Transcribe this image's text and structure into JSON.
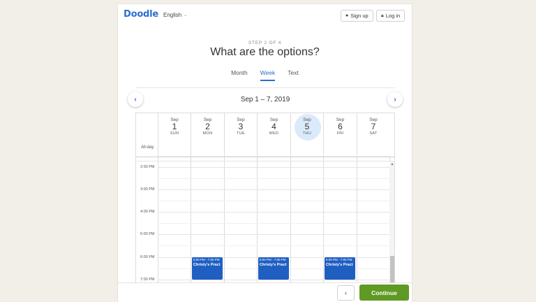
{
  "header": {
    "logo": "Doodle",
    "language": "English",
    "signup_label": "Sign up",
    "login_label": "Log in"
  },
  "step": "STEP 2 OF 4",
  "title": "What are the options?",
  "tabs": [
    {
      "label": "Month",
      "active": false
    },
    {
      "label": "Week",
      "active": true
    },
    {
      "label": "Text",
      "active": false
    }
  ],
  "calendar": {
    "range": "Sep 1 – 7, 2019",
    "all_day_label": "All-day",
    "days": [
      {
        "month": "Sep",
        "num": "1",
        "dow": "SUN",
        "today": false
      },
      {
        "month": "Sep",
        "num": "2",
        "dow": "MON",
        "today": false
      },
      {
        "month": "Sep",
        "num": "3",
        "dow": "TUE",
        "today": false
      },
      {
        "month": "Sep",
        "num": "4",
        "dow": "WED",
        "today": false
      },
      {
        "month": "Sep",
        "num": "5",
        "dow": "THU",
        "today": true
      },
      {
        "month": "Sep",
        "num": "6",
        "dow": "FRI",
        "today": false
      },
      {
        "month": "Sep",
        "num": "7",
        "dow": "SAT",
        "today": false
      }
    ],
    "times": [
      "2:00 PM",
      "3:00 PM",
      "4:00 PM",
      "5:00 PM",
      "6:00 PM",
      "7:00 PM"
    ],
    "events": [
      {
        "day": "MON",
        "time": "6:00 PM - 7:00 PM",
        "title": "Christy's Pract"
      },
      {
        "day": "WED",
        "time": "6:00 PM - 7:00 PM",
        "title": "Christy's Pract"
      },
      {
        "day": "FRI",
        "time": "6:00 PM - 7:00 PM",
        "title": "Christy's Pract"
      }
    ]
  },
  "footer": {
    "back_icon": "chevron-left-icon",
    "continue_label": "Continue"
  },
  "colors": {
    "brand_blue": "#2a6fd1",
    "event_blue": "#1f5fc2",
    "today_highlight": "#dbeafb",
    "continue_green": "#5f9a24"
  }
}
